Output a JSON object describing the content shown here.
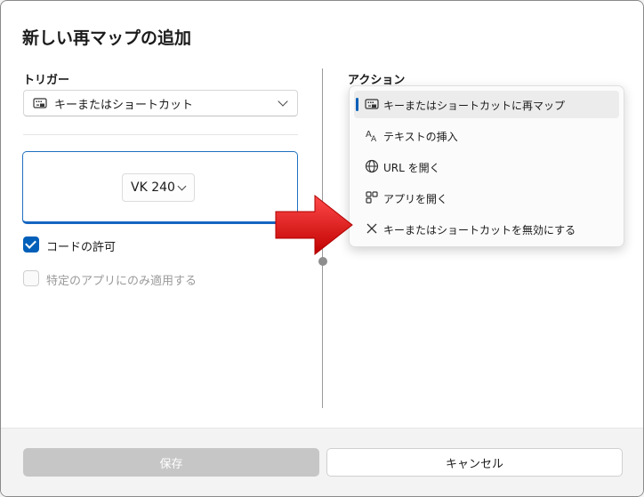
{
  "dialog": {
    "title": "新しい再マップの追加"
  },
  "trigger": {
    "label": "トリガー",
    "combo_value": "キーまたはショートカット",
    "key_value": "VK 240",
    "checkbox_code": {
      "label": "コードの許可",
      "checked": true
    },
    "checkbox_app": {
      "label": "特定のアプリにのみ適用する",
      "checked": false
    }
  },
  "action": {
    "label": "アクション",
    "menu": [
      {
        "label": "キーまたはショートカットに再マップ",
        "icon": "keyboard-icon",
        "selected": true
      },
      {
        "label": "テキストの挿入",
        "icon": "text-icon",
        "selected": false
      },
      {
        "label": "URL を開く",
        "icon": "globe-icon",
        "selected": false
      },
      {
        "label": "アプリを開く",
        "icon": "app-icon",
        "selected": false
      },
      {
        "label": "キーまたはショートカットを無効にする",
        "icon": "close-icon",
        "selected": false
      }
    ]
  },
  "footer": {
    "save_label": "保存",
    "cancel_label": "キャンセル"
  },
  "colors": {
    "accent": "#005fb8",
    "arrow": "#e02020"
  }
}
